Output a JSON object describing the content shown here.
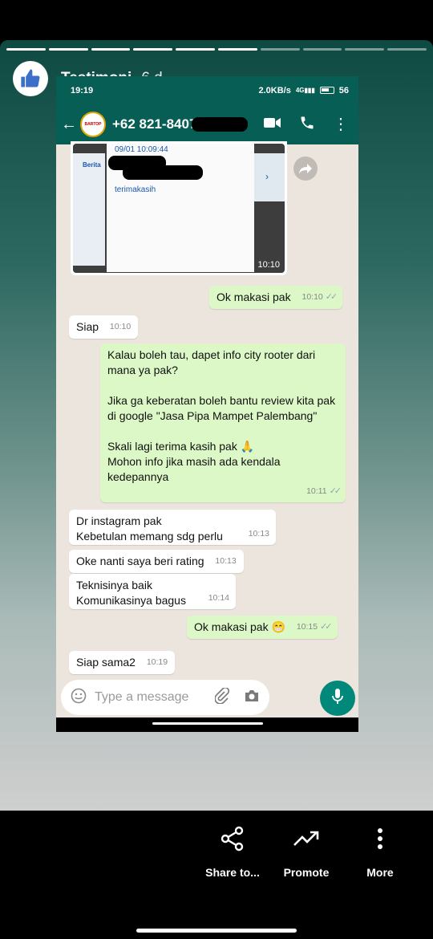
{
  "story": {
    "name": "Testimoni",
    "age": "6 d",
    "segments": 10,
    "current_segment": 6
  },
  "phone_status": {
    "time": "19:19",
    "speed": "2.0KB/s",
    "network": "4G",
    "battery": "56"
  },
  "chat_header": {
    "contact": "+62 821-8407",
    "avatar_label": "BARTOP"
  },
  "image_message": {
    "doc_datetime": "09/01 10:09:44",
    "doc_text": "terimakasih",
    "side_label": "Berita",
    "time": "10:10"
  },
  "messages": [
    {
      "dir": "out",
      "text": "Ok makasi pak",
      "time": "10:10"
    },
    {
      "dir": "in",
      "text": "Siap",
      "time": "10:10"
    },
    {
      "dir": "out",
      "text": "Kalau boleh tau, dapet info city rooter dari mana ya pak?\n\nJika ga keberatan boleh bantu review kita pak di google \"Jasa Pipa Mampet Palembang\"\n\nSkali lagi terima kasih pak 🙏\nMohon info jika masih ada kendala kedepannya",
      "time": "10:11"
    },
    {
      "dir": "in",
      "text": "Dr instagram pak\nKebetulan memang sdg perlu",
      "time": "10:13"
    },
    {
      "dir": "in",
      "text": "Oke nanti saya beri rating",
      "time": "10:13"
    },
    {
      "dir": "in",
      "text": "Teknisinya baik\nKomunikasinya bagus",
      "time": "10:14"
    },
    {
      "dir": "out",
      "text": "Ok makasi pak 😁",
      "time": "10:15"
    },
    {
      "dir": "in",
      "text": "Siap sama2",
      "time": "10:19"
    }
  ],
  "composer": {
    "placeholder": "Type a message"
  },
  "actions": {
    "share": "Share to...",
    "promote": "Promote",
    "more": "More"
  }
}
